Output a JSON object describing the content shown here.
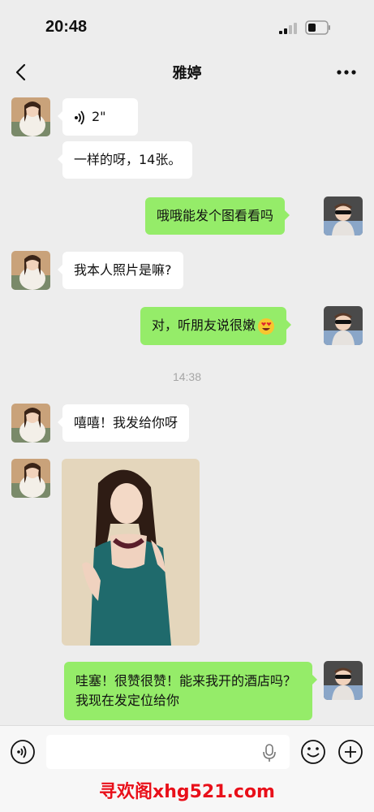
{
  "status_bar": {
    "time": "20:48"
  },
  "header": {
    "title": "雅婷"
  },
  "messages": [
    {
      "voice_duration": "2\""
    },
    {
      "text": "一样的呀，14张。"
    },
    {
      "text": "哦哦能发个图看看吗"
    },
    {
      "text": "我本人照片是嘛?"
    },
    {
      "text": "对，听朋友说很嫩"
    },
    {
      "text": "嘻嘻！我发给你呀"
    },
    {
      "text": "哇塞！很赞很赞！能来我开的酒店吗？我现在发定位给你"
    }
  ],
  "timestamp": "14:38",
  "icons": {
    "back": "chevron-left-icon",
    "more": "more-dots-icon",
    "voice_wave": "voice-wave-icon",
    "emoji": "heart-eyes-emoji-icon",
    "voice_toggle": "voice-toggle-icon",
    "mic": "mic-icon",
    "emoji_button": "smiley-icon",
    "plus": "plus-icon"
  },
  "colors": {
    "outgoing_bubble": "#95ec69",
    "incoming_bubble": "#ffffff",
    "background": "#ededed",
    "watermark": "#e8101a"
  },
  "watermark": "寻欢阁xhg521.com"
}
